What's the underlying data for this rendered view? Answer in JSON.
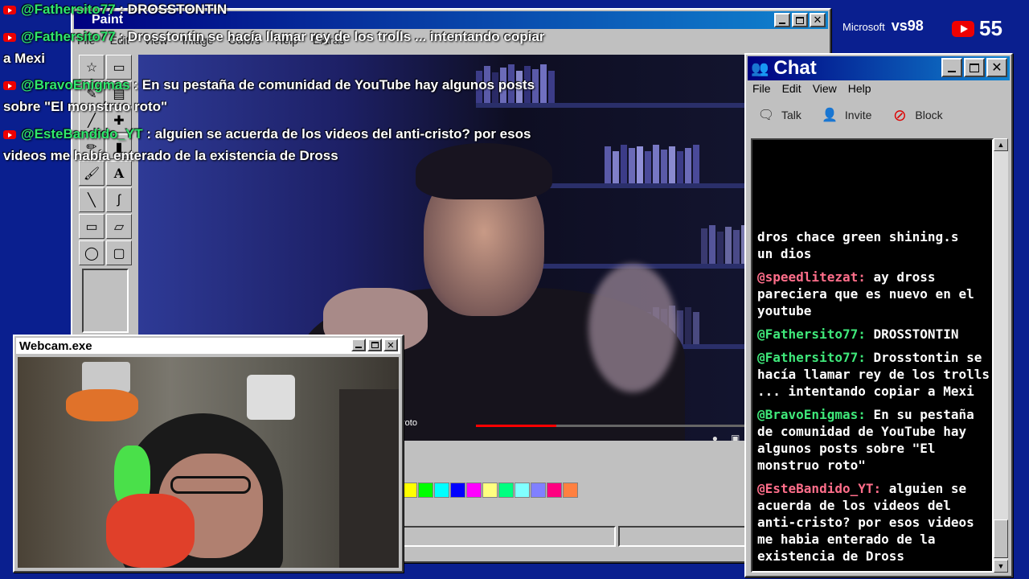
{
  "paint": {
    "title": "Paint",
    "menu": [
      "File",
      "Edit",
      "View",
      "Image",
      "Colors",
      "Help",
      "Extras"
    ],
    "tools": [
      "☆",
      "▭",
      "✎",
      "▤",
      "╱",
      "✚",
      "✏",
      "▮",
      "🖌",
      "A",
      "╲",
      "∫",
      "▭",
      "▱",
      "◯",
      "▢"
    ],
    "video_label": "roto",
    "palette": [
      "#ffff00",
      "#00ff00",
      "#00ffff",
      "#0000ff",
      "#ff00ff",
      "#ffff80",
      "#00ff80",
      "#80ffff",
      "#8080ff",
      "#ff0080",
      "#ff8040"
    ]
  },
  "overlay": [
    {
      "user": "@Fathersito77",
      "text": ": DROSSTONTIN",
      "cont": ""
    },
    {
      "user": "@Fathersito77",
      "text": ": Drosstontin se hacía llamar rey de los trolls ... intentando copiar",
      "cont": "a Mexi"
    },
    {
      "user": "@BravoEnigmas",
      "text": ": En su pestaña de comunidad de YouTube hay algunos posts",
      "cont": "sobre \"El monstruo roto\""
    },
    {
      "user": "@EsteBandido_YT",
      "text": ": alguien se acuerda de los videos del anti-cristo? por esos",
      "cont": "videos me había enterado de la existencia de Dross"
    }
  ],
  "webcam": {
    "title": "Webcam.exe"
  },
  "chat": {
    "title": "Chat",
    "menu": [
      "File",
      "Edit",
      "View",
      "Help"
    ],
    "tools": {
      "talk": "Talk",
      "invite": "Invite",
      "block": "Block"
    },
    "partial_top": "dros chace green shining.s",
    "partial_rest": "un dios",
    "messages": [
      {
        "user": "@speedlitezat:",
        "color": "pink",
        "text": "ay dross pareciera que es nuevo en el youtube"
      },
      {
        "user": "@Fathersito77:",
        "color": "green",
        "text": "DROSSTONTIN"
      },
      {
        "user": "@Fathersito77:",
        "color": "green",
        "text": "Drosstontin se hacía llamar rey de los trolls ... intentando copiar a Mexi"
      },
      {
        "user": "@BravoEnigmas:",
        "color": "green",
        "text": "En su pestaña de comunidad de YouTube hay algunos posts sobre \"El monstruo roto\""
      },
      {
        "user": "@EsteBandido_YT:",
        "color": "pink",
        "text": "alguien se acuerda de los videos del anti-cristo? por esos videos me habia enterado de la existencia de Dross"
      }
    ]
  },
  "top_right": {
    "brand": "Microsoft",
    "brand_suffix": "vs98",
    "viewer_count": "55"
  }
}
